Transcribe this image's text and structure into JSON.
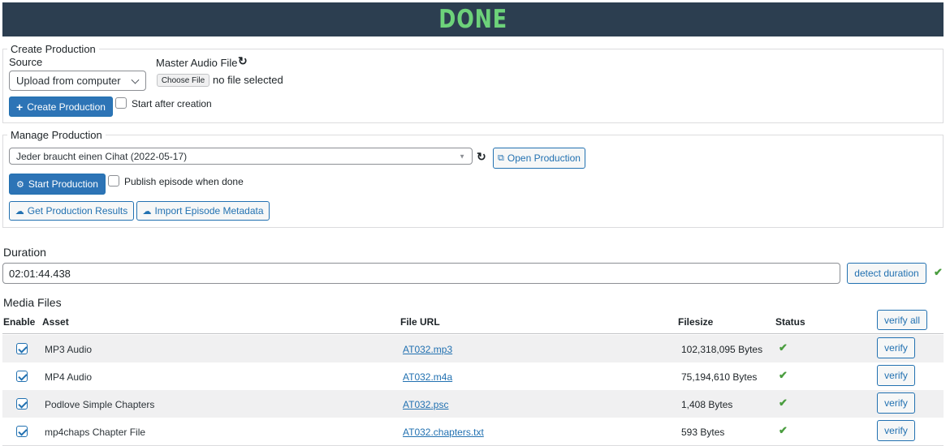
{
  "banner": {
    "status": "DONE",
    "color": "#6dd27a",
    "background": "#2c3e50"
  },
  "create_production": {
    "legend": "Create Production",
    "source_label": "Source",
    "source_selected": "Upload from computer",
    "master_audio_label": "Master Audio File",
    "choose_file_label": "Choose File",
    "no_file_text": "no file selected",
    "create_button": "Create Production",
    "start_after_label": "Start after creation"
  },
  "manage_production": {
    "legend": "Manage Production",
    "production_selected": "Jeder braucht einen Cihat (2022-05-17)",
    "open_button": "Open Production",
    "start_button": "Start Production",
    "publish_label": "Publish episode when done",
    "get_results_button": "Get Production Results",
    "import_metadata_button": "Import Episode Metadata"
  },
  "duration": {
    "title": "Duration",
    "value": "02:01:44.438",
    "detect_button": "detect duration"
  },
  "media_files": {
    "title": "Media Files",
    "headers": {
      "enable": "Enable",
      "asset": "Asset",
      "file_url": "File URL",
      "filesize": "Filesize",
      "status": "Status"
    },
    "verify_all_button": "verify all",
    "verify_button": "verify",
    "rows": [
      {
        "enabled": true,
        "asset": "MP3 Audio",
        "file_url": "AT032.mp3",
        "filesize": "102,318,095 Bytes",
        "status": "ok"
      },
      {
        "enabled": true,
        "asset": "MP4 Audio",
        "file_url": "AT032.m4a",
        "filesize": "75,194,610 Bytes",
        "status": "ok"
      },
      {
        "enabled": true,
        "asset": "Podlove Simple Chapters",
        "file_url": "AT032.psc",
        "filesize": "1,408 Bytes",
        "status": "ok"
      },
      {
        "enabled": true,
        "asset": "mp4chaps Chapter File",
        "file_url": "AT032.chapters.txt",
        "filesize": "593 Bytes",
        "status": "ok"
      }
    ]
  },
  "colors": {
    "accent": "#2271b1",
    "success": "#4a9d3f"
  },
  "icons": {
    "refresh": "refresh-icon",
    "plus": "plus-icon",
    "external": "external-link-icon",
    "gears": "gears-icon",
    "cloud": "cloud-download-icon",
    "check": "check-icon"
  }
}
